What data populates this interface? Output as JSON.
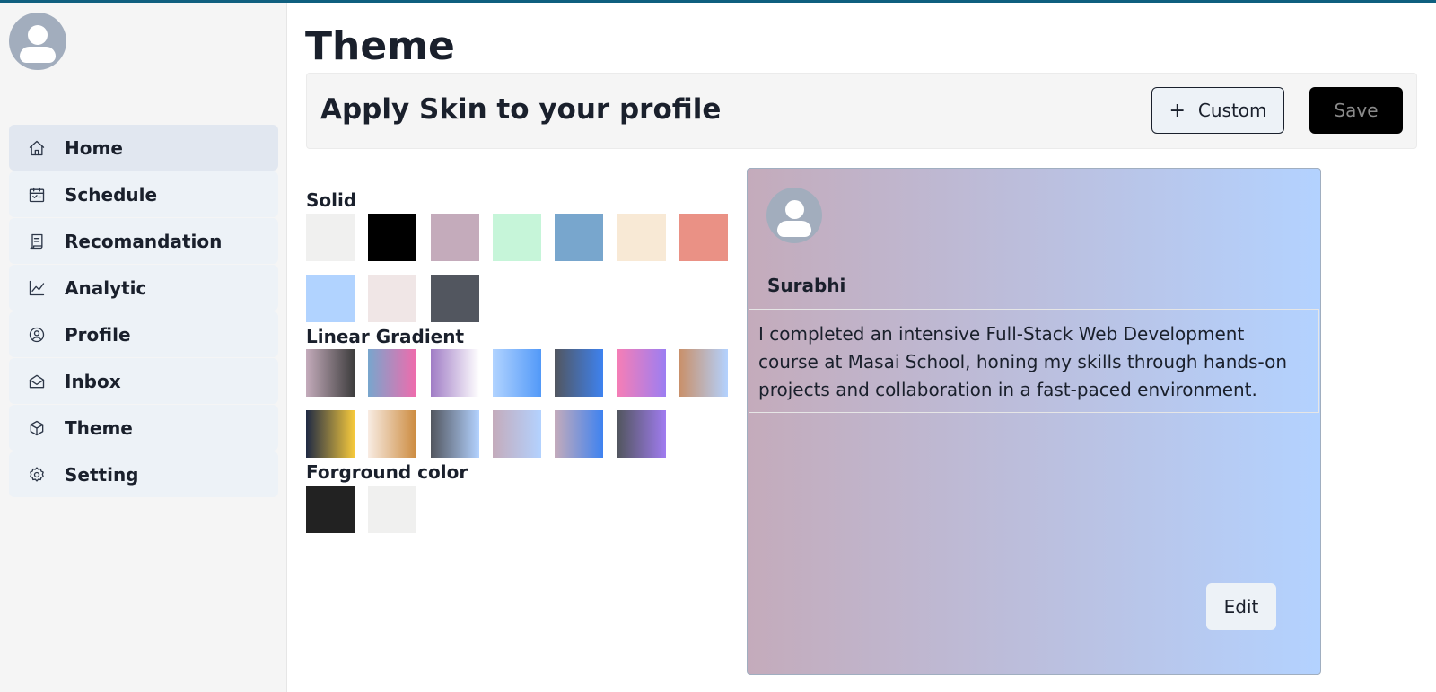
{
  "page": {
    "title": "Theme"
  },
  "sidebar": {
    "items": [
      {
        "label": "Home",
        "icon": "home-icon",
        "active": true
      },
      {
        "label": "Schedule",
        "icon": "calendar-icon"
      },
      {
        "label": "Recomandation",
        "icon": "scroll-icon"
      },
      {
        "label": "Analytic",
        "icon": "line-chart-icon"
      },
      {
        "label": "Profile",
        "icon": "user-circle-icon"
      },
      {
        "label": "Inbox",
        "icon": "mail-icon"
      },
      {
        "label": "Theme",
        "icon": "cube-icon"
      },
      {
        "label": "Setting",
        "icon": "gear-icon"
      }
    ]
  },
  "header": {
    "title": "Apply Skin to your profile",
    "custom_label": "Custom",
    "save_label": "Save"
  },
  "solid": {
    "label": "Solid",
    "colors": [
      "#f0f0ef",
      "#000000",
      "#c4abbb",
      "#c6f5d9",
      "#78a6cd",
      "#f8e9d5",
      "#ea9185",
      "#b1d3ff",
      "#f0e6e6",
      "#52565f"
    ]
  },
  "gradient": {
    "label": "Linear Gradient",
    "gradients": [
      [
        "#c4abbb",
        "#3d3d3d"
      ],
      [
        "#78a6cd",
        "#f06bac"
      ],
      [
        "#a07cc5",
        "#ffffff"
      ],
      [
        "#b1d3ff",
        "#5299f8"
      ],
      [
        "#52565f",
        "#3e82f0"
      ],
      [
        "#f57eb6",
        "#9c7ef2"
      ],
      [
        "#c9906a",
        "#b3d2ff"
      ],
      [
        "#1f2a44",
        "#f6c93c"
      ],
      [
        "#f8ece3",
        "#cc8b3f"
      ],
      [
        "#52565f",
        "#b3d2ff"
      ],
      [
        "#c4abbb",
        "#b3d2ff"
      ],
      [
        "#c4abbb",
        "#3e82f0"
      ],
      [
        "#52565f",
        "#a07cf0"
      ]
    ]
  },
  "foreground": {
    "label": "Forground color",
    "colors": [
      "#222222",
      "#f0f0ef"
    ]
  },
  "preview": {
    "name": "Surabhi",
    "bio": "I completed an intensive Full-Stack Web Development course at Masai School, honing my skills through hands-on projects and collaboration in a fast-paced environment.",
    "edit_label": "Edit",
    "gradient": [
      "#c4abbb",
      "#b3d2ff"
    ]
  }
}
